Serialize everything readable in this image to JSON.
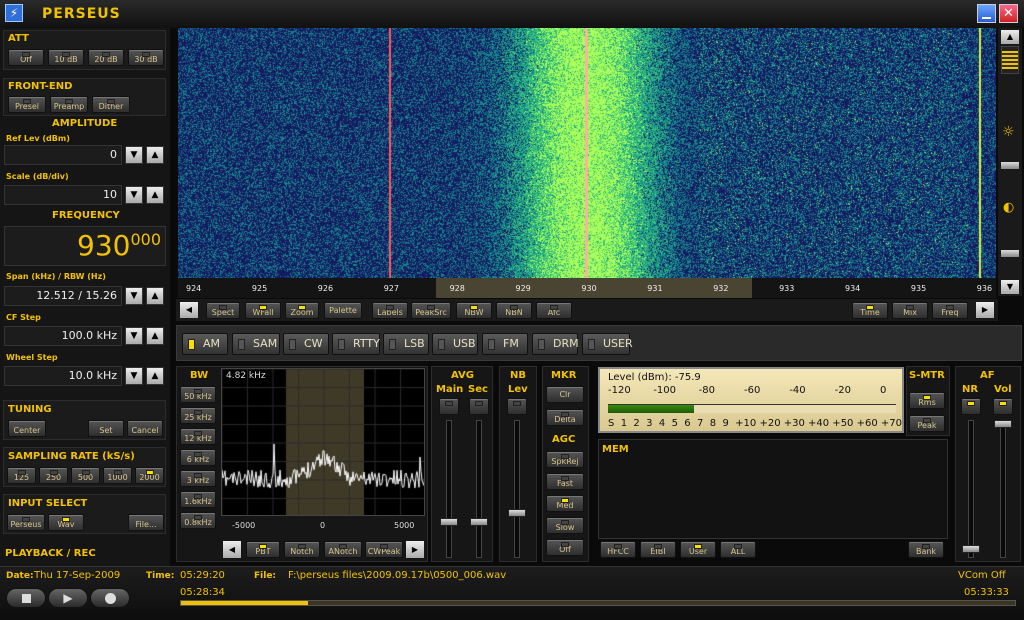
{
  "app": {
    "title": "PERSEUS"
  },
  "att": {
    "title": "ATT",
    "buttons": [
      "Off",
      "10 dB",
      "20 dB",
      "30 dB"
    ]
  },
  "frontend": {
    "title": "FRONT-END",
    "buttons": [
      "Presel",
      "Preamp",
      "Dither"
    ]
  },
  "amplitude": {
    "title": "AMPLITUDE",
    "ref_label": "Ref Lev (dBm)",
    "ref_value": "0",
    "scale_label": "Scale (dB/div)",
    "scale_value": "10"
  },
  "frequency": {
    "title": "FREQUENCY",
    "main": "930",
    "sub": "000",
    "span_label": "Span (kHz) / RBW (Hz)",
    "span_value": "12.512 / 15.26",
    "cf_label": "CF Step",
    "cf_value": "100.0 kHz",
    "wheel_label": "Wheel Step",
    "wheel_value": "10.0 kHz"
  },
  "tuning": {
    "title": "TUNING",
    "buttons": [
      "Center",
      "Set",
      "Cancel"
    ]
  },
  "sampling": {
    "title": "SAMPLING RATE (kS/s)",
    "buttons": [
      "125",
      "250",
      "500",
      "1000",
      "2000"
    ],
    "active": "2000"
  },
  "input": {
    "title": "INPUT SELECT",
    "buttons": [
      "Perseus",
      "Wav",
      "File..."
    ]
  },
  "playback": {
    "title": "PLAYBACK / REC"
  },
  "waterfall": {
    "freq_ticks": [
      "924",
      "925",
      "926",
      "927",
      "928",
      "929",
      "930",
      "931",
      "932",
      "933",
      "934",
      "935",
      "936"
    ]
  },
  "toolbar": {
    "left": [
      "Spect",
      "WFall",
      "Zoom"
    ],
    "palette": "Palette",
    "mid": [
      "Labels",
      "PeakSrc",
      "NBW",
      "NBN",
      "Afc"
    ],
    "right": [
      "Time",
      "Mix",
      "Freq"
    ]
  },
  "modes": [
    "AM",
    "SAM",
    "CW",
    "RTTY",
    "LSB",
    "USB",
    "FM",
    "DRM",
    "USER"
  ],
  "bw": {
    "title": "BW",
    "buttons": [
      "50 kHz",
      "25 kHz",
      "12 kHz",
      "6 kHz",
      "3 kHz",
      "1.6kHz",
      "0.8kHz"
    ],
    "display": "4.82 kHz",
    "axis": [
      "-5000",
      "0",
      "5000"
    ],
    "bottom_buttons": [
      "PBT",
      "Notch",
      "ANotch",
      "CWPeak"
    ]
  },
  "avg": {
    "title": "AVG",
    "main": "Main",
    "sec": "Sec"
  },
  "nb": {
    "title": "NB",
    "lev": "Lev"
  },
  "mkr": {
    "title": "MKR",
    "buttons": [
      "Clr",
      "Delta"
    ]
  },
  "agc": {
    "title": "AGC",
    "buttons": [
      "SpkRej",
      "Fast",
      "Med",
      "Slow",
      "Off"
    ],
    "active": "Med"
  },
  "smeter": {
    "level_text": "Level (dBm): -75.9",
    "top_scale": [
      "-120",
      "-100",
      "-80",
      "-60",
      "-40",
      "-20",
      "0"
    ],
    "bottom_scale": "S  1  2  3  4  5  6  7  8  9  +10 +20 +30 +40 +50 +60 +70",
    "level": -75.9
  },
  "smtr": {
    "title": "S-MTR",
    "buttons": [
      "Rms",
      "Peak"
    ]
  },
  "af": {
    "title": "AF",
    "nr": "NR",
    "vol": "Vol"
  },
  "mem": {
    "title": "MEM",
    "buttons": [
      "HFCC",
      "EIBI",
      "User",
      "ALL"
    ],
    "bank": "Bank"
  },
  "status": {
    "date_label": "Date:",
    "date_value": "Thu 17-Sep-2009",
    "time_label": "Time:",
    "time_value": "05:29:20",
    "file_label": "File:",
    "file_value": "F:\\perseus files\\2009.09.17b\\0500_006.wav",
    "vcom": "VCom Off",
    "start_time": "05:28:34",
    "end_time": "05:33:33",
    "progress": 0.3
  },
  "colors": {
    "accent": "#f2c200",
    "led_on": "#f5e000",
    "waterfall_bg": "#15125a"
  }
}
